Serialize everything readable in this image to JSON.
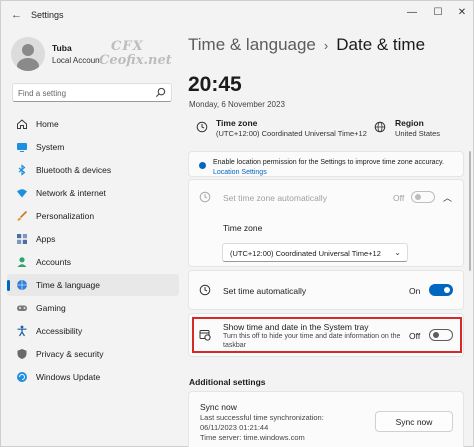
{
  "window": {
    "title": "Settings",
    "controls": {
      "minimize": "—",
      "maximize": "☐",
      "close": "✕"
    }
  },
  "user": {
    "name": "Tuba",
    "account_type": "Local Account"
  },
  "watermark": {
    "line1": "CFX",
    "line2": "Ceofix.net"
  },
  "search": {
    "placeholder": "Find a setting"
  },
  "nav": {
    "items": [
      {
        "label": "Home",
        "icon": "home-icon"
      },
      {
        "label": "System",
        "icon": "monitor-icon"
      },
      {
        "label": "Bluetooth & devices",
        "icon": "bluetooth-icon"
      },
      {
        "label": "Network & internet",
        "icon": "wifi-icon"
      },
      {
        "label": "Personalization",
        "icon": "brush-icon"
      },
      {
        "label": "Apps",
        "icon": "apps-icon"
      },
      {
        "label": "Accounts",
        "icon": "person-icon"
      },
      {
        "label": "Time & language",
        "icon": "globe-clock-icon",
        "selected": true
      },
      {
        "label": "Gaming",
        "icon": "gamepad-icon"
      },
      {
        "label": "Accessibility",
        "icon": "accessibility-icon"
      },
      {
        "label": "Privacy & security",
        "icon": "shield-icon"
      },
      {
        "label": "Windows Update",
        "icon": "update-icon"
      }
    ]
  },
  "header": {
    "parent": "Time & language",
    "separator": "›",
    "title": "Date & time"
  },
  "clock": {
    "time": "20:45",
    "date": "Monday, 6 November 2023"
  },
  "summary": {
    "time_zone": {
      "label": "Time zone",
      "value": "(UTC+12:00) Coordinated Universal Time+12"
    },
    "region": {
      "label": "Region",
      "value": "United States"
    }
  },
  "location_banner": {
    "text": "Enable location permission for the Settings to improve time zone accuracy.",
    "link": "Location Settings"
  },
  "set_tz_auto": {
    "label": "Set time zone automatically",
    "state": "Off"
  },
  "time_zone_select": {
    "label": "Time zone",
    "value": "(UTC+12:00) Coordinated Universal Time+12"
  },
  "set_time_auto": {
    "label": "Set time automatically",
    "state": "On"
  },
  "show_tray": {
    "label": "Show time and date in the System tray",
    "description": "Turn this off to hide your time and date information on the taskbar",
    "state": "Off"
  },
  "additional": {
    "title": "Additional settings",
    "sync": {
      "title": "Sync now",
      "line1": "Last successful time synchronization:",
      "line2": "06/11/2023 01:21:44",
      "line3": "Time server: time.windows.com",
      "button": "Sync now"
    }
  },
  "colors": {
    "accent": "#0067c0",
    "highlight_border": "#d42a2a",
    "background": "#f3f3f3"
  }
}
